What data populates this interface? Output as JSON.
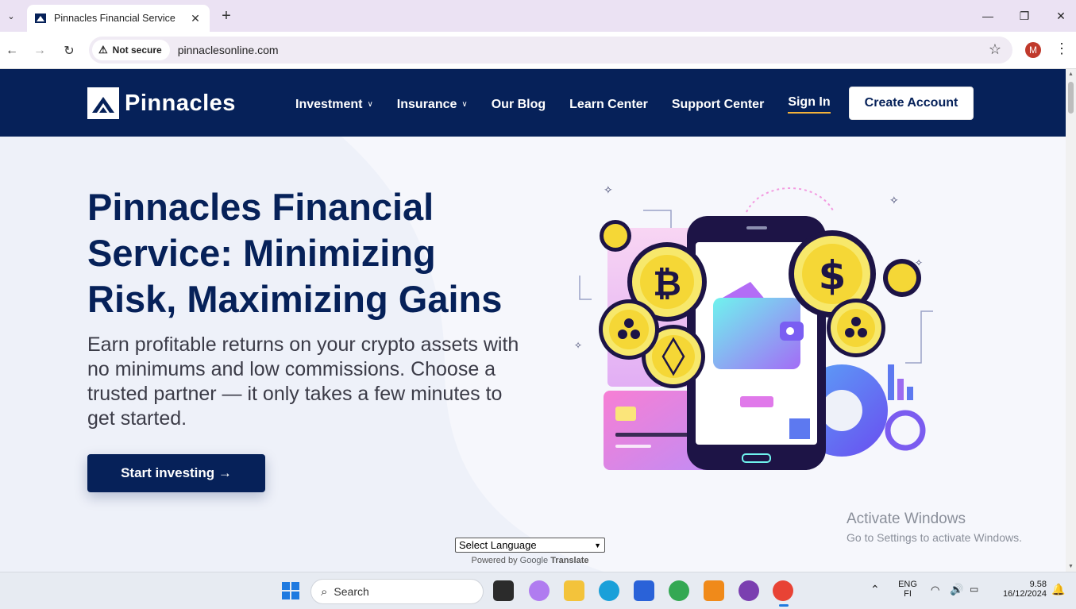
{
  "browser": {
    "tab_title": "Pinnacles Financial Service",
    "security_label": "Not secure",
    "url": "pinnaclesonline.com",
    "profile_initial": "M"
  },
  "site": {
    "logo_text": "Pinnacles",
    "menu": [
      {
        "label": "Investment",
        "dropdown": true
      },
      {
        "label": "Insurance",
        "dropdown": true
      },
      {
        "label": "Our Blog",
        "dropdown": false
      },
      {
        "label": "Learn Center",
        "dropdown": false
      },
      {
        "label": "Support Center",
        "dropdown": false
      },
      {
        "label": "Sign In",
        "dropdown": false
      }
    ],
    "create_account": "Create Account"
  },
  "hero": {
    "title": "Pinnacles Financial Service: Minimizing Risk, Maximizing Gains",
    "subtitle": "Earn profitable returns on your crypto assets with no minimums and low commissions. Choose a trusted partner — it only takes a few minutes to get started.",
    "cta": "Start investing →"
  },
  "translate": {
    "select_label": "Select Language",
    "powered_prefix": "Powered by",
    "google": "Google",
    "translate": "Translate"
  },
  "watermark": {
    "line1": "Activate Windows",
    "line2": "Go to Settings to activate Windows."
  },
  "taskbar": {
    "search_placeholder": "Search",
    "lang_line1": "ENG",
    "lang_line2": "FI",
    "time": "9.58",
    "date": "16/12/2024"
  },
  "colors": {
    "navy": "#062159",
    "accent_underline": "#f3b23a",
    "profile": "#c0392b"
  }
}
